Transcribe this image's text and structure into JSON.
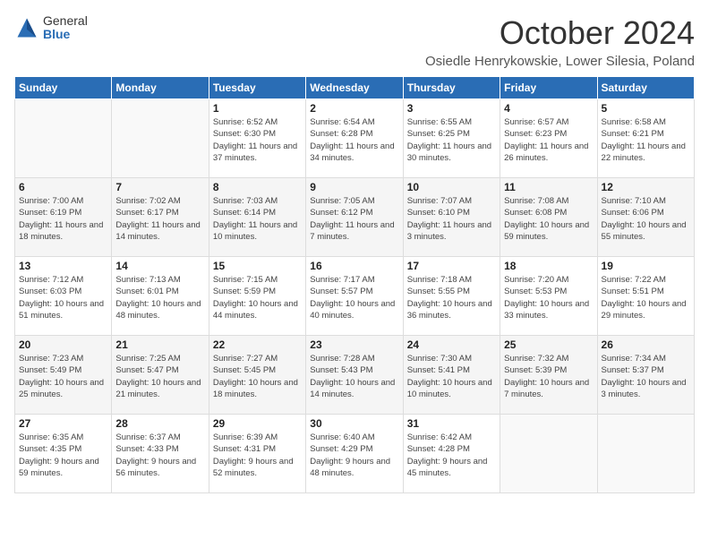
{
  "logo": {
    "general": "General",
    "blue": "Blue"
  },
  "title": "October 2024",
  "location": "Osiedle Henrykowskie, Lower Silesia, Poland",
  "headers": [
    "Sunday",
    "Monday",
    "Tuesday",
    "Wednesday",
    "Thursday",
    "Friday",
    "Saturday"
  ],
  "weeks": [
    [
      {
        "day": "",
        "sunrise": "",
        "sunset": "",
        "daylight": ""
      },
      {
        "day": "",
        "sunrise": "",
        "sunset": "",
        "daylight": ""
      },
      {
        "day": "1",
        "sunrise": "Sunrise: 6:52 AM",
        "sunset": "Sunset: 6:30 PM",
        "daylight": "Daylight: 11 hours and 37 minutes."
      },
      {
        "day": "2",
        "sunrise": "Sunrise: 6:54 AM",
        "sunset": "Sunset: 6:28 PM",
        "daylight": "Daylight: 11 hours and 34 minutes."
      },
      {
        "day": "3",
        "sunrise": "Sunrise: 6:55 AM",
        "sunset": "Sunset: 6:25 PM",
        "daylight": "Daylight: 11 hours and 30 minutes."
      },
      {
        "day": "4",
        "sunrise": "Sunrise: 6:57 AM",
        "sunset": "Sunset: 6:23 PM",
        "daylight": "Daylight: 11 hours and 26 minutes."
      },
      {
        "day": "5",
        "sunrise": "Sunrise: 6:58 AM",
        "sunset": "Sunset: 6:21 PM",
        "daylight": "Daylight: 11 hours and 22 minutes."
      }
    ],
    [
      {
        "day": "6",
        "sunrise": "Sunrise: 7:00 AM",
        "sunset": "Sunset: 6:19 PM",
        "daylight": "Daylight: 11 hours and 18 minutes."
      },
      {
        "day": "7",
        "sunrise": "Sunrise: 7:02 AM",
        "sunset": "Sunset: 6:17 PM",
        "daylight": "Daylight: 11 hours and 14 minutes."
      },
      {
        "day": "8",
        "sunrise": "Sunrise: 7:03 AM",
        "sunset": "Sunset: 6:14 PM",
        "daylight": "Daylight: 11 hours and 10 minutes."
      },
      {
        "day": "9",
        "sunrise": "Sunrise: 7:05 AM",
        "sunset": "Sunset: 6:12 PM",
        "daylight": "Daylight: 11 hours and 7 minutes."
      },
      {
        "day": "10",
        "sunrise": "Sunrise: 7:07 AM",
        "sunset": "Sunset: 6:10 PM",
        "daylight": "Daylight: 11 hours and 3 minutes."
      },
      {
        "day": "11",
        "sunrise": "Sunrise: 7:08 AM",
        "sunset": "Sunset: 6:08 PM",
        "daylight": "Daylight: 10 hours and 59 minutes."
      },
      {
        "day": "12",
        "sunrise": "Sunrise: 7:10 AM",
        "sunset": "Sunset: 6:06 PM",
        "daylight": "Daylight: 10 hours and 55 minutes."
      }
    ],
    [
      {
        "day": "13",
        "sunrise": "Sunrise: 7:12 AM",
        "sunset": "Sunset: 6:03 PM",
        "daylight": "Daylight: 10 hours and 51 minutes."
      },
      {
        "day": "14",
        "sunrise": "Sunrise: 7:13 AM",
        "sunset": "Sunset: 6:01 PM",
        "daylight": "Daylight: 10 hours and 48 minutes."
      },
      {
        "day": "15",
        "sunrise": "Sunrise: 7:15 AM",
        "sunset": "Sunset: 5:59 PM",
        "daylight": "Daylight: 10 hours and 44 minutes."
      },
      {
        "day": "16",
        "sunrise": "Sunrise: 7:17 AM",
        "sunset": "Sunset: 5:57 PM",
        "daylight": "Daylight: 10 hours and 40 minutes."
      },
      {
        "day": "17",
        "sunrise": "Sunrise: 7:18 AM",
        "sunset": "Sunset: 5:55 PM",
        "daylight": "Daylight: 10 hours and 36 minutes."
      },
      {
        "day": "18",
        "sunrise": "Sunrise: 7:20 AM",
        "sunset": "Sunset: 5:53 PM",
        "daylight": "Daylight: 10 hours and 33 minutes."
      },
      {
        "day": "19",
        "sunrise": "Sunrise: 7:22 AM",
        "sunset": "Sunset: 5:51 PM",
        "daylight": "Daylight: 10 hours and 29 minutes."
      }
    ],
    [
      {
        "day": "20",
        "sunrise": "Sunrise: 7:23 AM",
        "sunset": "Sunset: 5:49 PM",
        "daylight": "Daylight: 10 hours and 25 minutes."
      },
      {
        "day": "21",
        "sunrise": "Sunrise: 7:25 AM",
        "sunset": "Sunset: 5:47 PM",
        "daylight": "Daylight: 10 hours and 21 minutes."
      },
      {
        "day": "22",
        "sunrise": "Sunrise: 7:27 AM",
        "sunset": "Sunset: 5:45 PM",
        "daylight": "Daylight: 10 hours and 18 minutes."
      },
      {
        "day": "23",
        "sunrise": "Sunrise: 7:28 AM",
        "sunset": "Sunset: 5:43 PM",
        "daylight": "Daylight: 10 hours and 14 minutes."
      },
      {
        "day": "24",
        "sunrise": "Sunrise: 7:30 AM",
        "sunset": "Sunset: 5:41 PM",
        "daylight": "Daylight: 10 hours and 10 minutes."
      },
      {
        "day": "25",
        "sunrise": "Sunrise: 7:32 AM",
        "sunset": "Sunset: 5:39 PM",
        "daylight": "Daylight: 10 hours and 7 minutes."
      },
      {
        "day": "26",
        "sunrise": "Sunrise: 7:34 AM",
        "sunset": "Sunset: 5:37 PM",
        "daylight": "Daylight: 10 hours and 3 minutes."
      }
    ],
    [
      {
        "day": "27",
        "sunrise": "Sunrise: 6:35 AM",
        "sunset": "Sunset: 4:35 PM",
        "daylight": "Daylight: 9 hours and 59 minutes."
      },
      {
        "day": "28",
        "sunrise": "Sunrise: 6:37 AM",
        "sunset": "Sunset: 4:33 PM",
        "daylight": "Daylight: 9 hours and 56 minutes."
      },
      {
        "day": "29",
        "sunrise": "Sunrise: 6:39 AM",
        "sunset": "Sunset: 4:31 PM",
        "daylight": "Daylight: 9 hours and 52 minutes."
      },
      {
        "day": "30",
        "sunrise": "Sunrise: 6:40 AM",
        "sunset": "Sunset: 4:29 PM",
        "daylight": "Daylight: 9 hours and 48 minutes."
      },
      {
        "day": "31",
        "sunrise": "Sunrise: 6:42 AM",
        "sunset": "Sunset: 4:28 PM",
        "daylight": "Daylight: 9 hours and 45 minutes."
      },
      {
        "day": "",
        "sunrise": "",
        "sunset": "",
        "daylight": ""
      },
      {
        "day": "",
        "sunrise": "",
        "sunset": "",
        "daylight": ""
      }
    ]
  ]
}
